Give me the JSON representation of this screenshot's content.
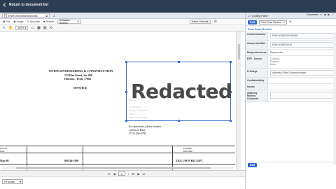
{
  "topbar": {
    "back_label": "Return to document list"
  },
  "doc_tab": {
    "label": "ENR-0000000034/0081"
  },
  "toolbar": {
    "items": [
      "File",
      "Image",
      "Annotate",
      "Redact"
    ],
    "zoom_value": "100%",
    "reason_placeholder": "Redaction Reason",
    "mode_value": "Native Default"
  },
  "document": {
    "company": "UNION ENGINEERING & CONSTRUCTION",
    "address1": "123 Elm Street, Ste 400",
    "address2": "Houston , Texas  77002",
    "doc_title": "INVOICE",
    "redact_label": "Redacted",
    "ghost_lines": [
      "Bill To:",
      "Contract #",
      "Project Number:",
      "Job #: ",
      "Date Submitted"
    ],
    "contact_line1": "For questions, please contact:",
    "contact_line2": "Cameron Bass",
    "contact_line3": "(713) 346-4785",
    "table_headers": [
      "Invoice",
      "Date",
      "Payment",
      "Due Date"
    ],
    "table_row": [
      "May-08",
      "089746-1998",
      "DUE UPON RECEIPT"
    ]
  },
  "pager": {
    "current": "1",
    "separator": "/",
    "total": "35"
  },
  "zoom_select": "Fit Width",
  "right_panel": {
    "header_tab": "Coding Pane",
    "header_right": "Document",
    "layout_select": "First Pass Review",
    "section_title": "First Pass Review",
    "edit_label": "Edit",
    "fields": [
      {
        "label": "Control Number",
        "value": "ENR-0000000034/0081"
      },
      {
        "label": "Group Identifier",
        "value": "ENR-0000000034"
      },
      {
        "label": "Responsiveness",
        "value": "Responsive"
      },
      {
        "label": "EYE - Issues",
        "value": "Contract\nFinance\nMore"
      },
      {
        "label": "Privilege",
        "value": "Attorney Client Communication"
      },
      {
        "label": "Confidentiality",
        "value": ""
      },
      {
        "label": "Issues",
        "value": ""
      },
      {
        "label": "Attorney Review Comment",
        "value": ""
      }
    ],
    "footer_edit": "Edit"
  }
}
